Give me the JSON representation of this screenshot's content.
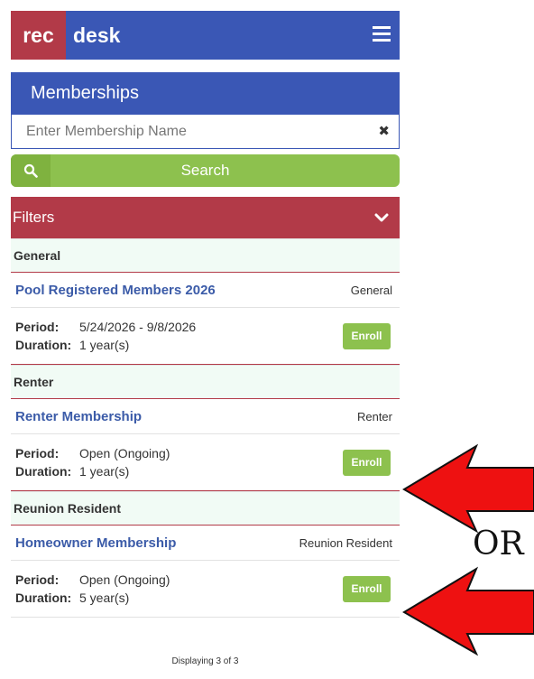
{
  "header": {
    "logo_rec": "rec",
    "logo_desk": "desk",
    "menu_icon": "hamburger-icon"
  },
  "page": {
    "title": "Memberships"
  },
  "search": {
    "placeholder": "Enter Membership Name",
    "value": "",
    "button_label": "Search",
    "search_icon": "magnifier-icon",
    "clear_icon": "close-icon"
  },
  "filters": {
    "label": "Filters",
    "icon": "chevron-down-icon"
  },
  "groups": [
    {
      "header": "General",
      "item": {
        "name": "Pool Registered Members 2026",
        "category": "General",
        "period_label": "Period:",
        "period": "5/24/2026 - 9/8/2026",
        "duration_label": "Duration:",
        "duration": "1 year(s)",
        "enroll_label": "Enroll"
      }
    },
    {
      "header": "Renter",
      "item": {
        "name": "Renter Membership",
        "category": "Renter",
        "period_label": "Period:",
        "period": "Open (Ongoing)",
        "duration_label": "Duration:",
        "duration": "1 year(s)",
        "enroll_label": "Enroll"
      }
    },
    {
      "header": "Reunion Resident",
      "item": {
        "name": "Homeowner Membership",
        "category": "Reunion Resident",
        "period_label": "Period:",
        "period": "Open (Ongoing)",
        "duration_label": "Duration:",
        "duration": "5 year(s)",
        "enroll_label": "Enroll"
      }
    }
  ],
  "footer": {
    "display_text": "Displaying 3 of 3"
  },
  "annotation": {
    "or_text": "OR",
    "arrow_color": "#ee1111"
  },
  "colors": {
    "brand_blue": "#3a57b5",
    "brand_red": "#b23a48",
    "accent_green": "#8dc14e"
  }
}
